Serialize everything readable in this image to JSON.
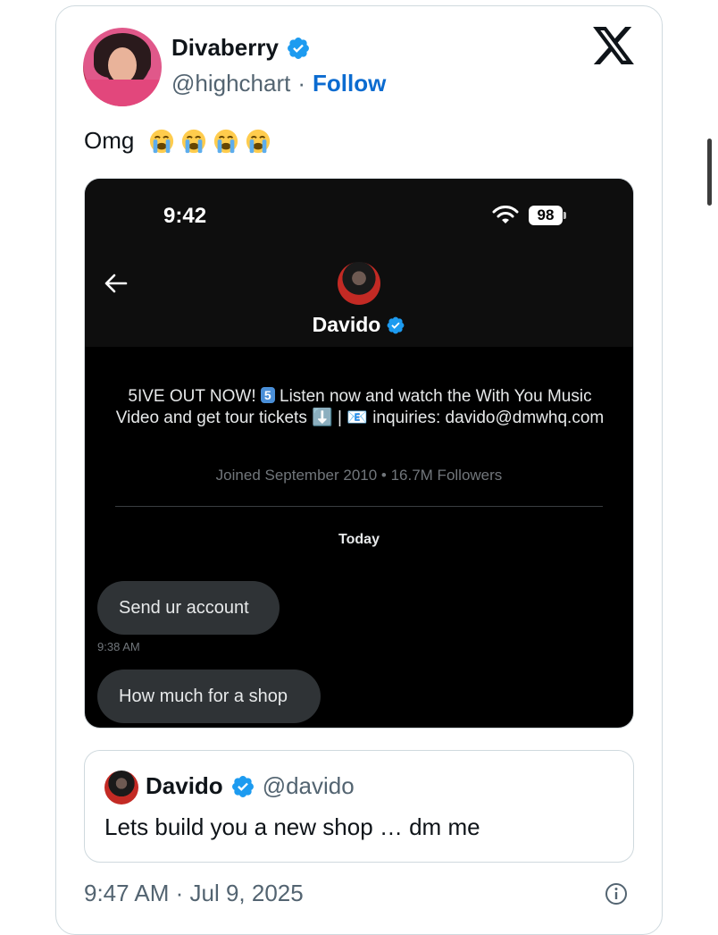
{
  "author": {
    "display_name": "Divaberry",
    "handle": "@highchart",
    "separator": "·",
    "follow_label": "Follow"
  },
  "tweet": {
    "text": "Omg",
    "emoji_count": 4,
    "timestamp": "9:47 AM · Jul 9, 2025"
  },
  "screenshot": {
    "status_time": "9:42",
    "battery": "98",
    "profile_name": "Davido",
    "bio_part1": "5IVE OUT NOW! ",
    "bio_badge": "5",
    "bio_part2": " Listen now and watch the With You Music Video and get tour tickets ⬇️ | 📧 inquiries: davido@dmwhq.com",
    "meta": "Joined September 2010 • 16.7M Followers",
    "day_label": "Today",
    "messages": [
      {
        "text": "Send ur account",
        "time": "9:38 AM"
      },
      {
        "text": "How much for a shop"
      }
    ]
  },
  "quote": {
    "display_name": "Davido",
    "handle": "@davido",
    "text": "Lets build you  a new shop … dm me"
  },
  "colors": {
    "accent": "#0b6bd0",
    "verified": "#1d9bf0",
    "dm_background": "#000000",
    "bubble": "#2f3336"
  },
  "icons": [
    "verified-badge-icon",
    "x-logo-icon",
    "loudly-crying-face-emoji",
    "wifi-icon",
    "battery-icon",
    "back-arrow-icon",
    "info-icon"
  ]
}
